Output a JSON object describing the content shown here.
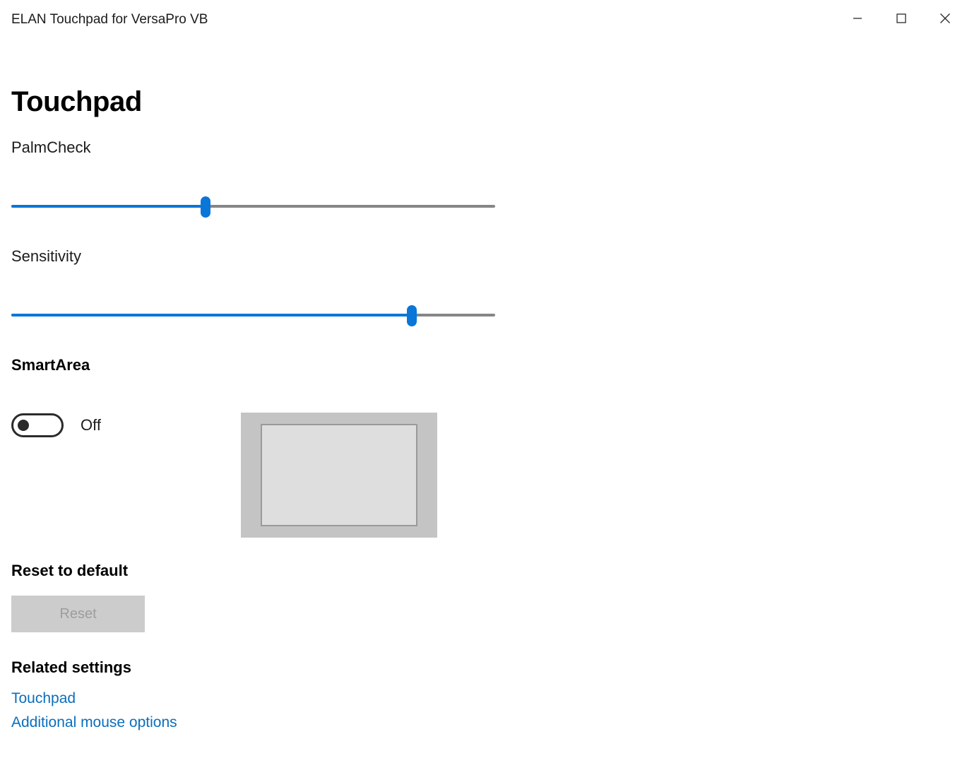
{
  "window": {
    "title": "ELAN Touchpad for VersaPro VB",
    "caption_buttons": [
      {
        "name": "minimize",
        "glyph": "—"
      },
      {
        "name": "maximize",
        "glyph": "□"
      },
      {
        "name": "close",
        "glyph": "✕"
      }
    ]
  },
  "page": {
    "title": "Touchpad"
  },
  "palmcheck": {
    "label": "PalmCheck",
    "value": 40,
    "min": 0,
    "max": 100,
    "fill_percent": "40.1%",
    "thumb_percent": "40.1%"
  },
  "sensitivity": {
    "label": "Sensitivity",
    "value": 83,
    "min": 0,
    "max": 100,
    "fill_percent": "82.8%",
    "thumb_percent": "82.8%"
  },
  "smartarea": {
    "heading": "SmartArea",
    "state_label": "Off",
    "enabled": false
  },
  "reset": {
    "heading": "Reset to default",
    "button_label": "Reset",
    "enabled": false
  },
  "related": {
    "heading": "Related settings",
    "links": [
      {
        "label": "Touchpad"
      },
      {
        "label": "Additional mouse options"
      }
    ]
  },
  "colors": {
    "accent": "#0a76d8",
    "link": "#0a6ebd",
    "track": "#868686",
    "preview_frame": "#c4c4c4",
    "preview_inner": "#dedede",
    "preview_border": "#9a9a9a",
    "button_disabled_bg": "#cccccc",
    "button_disabled_text": "#9d9d9d"
  }
}
